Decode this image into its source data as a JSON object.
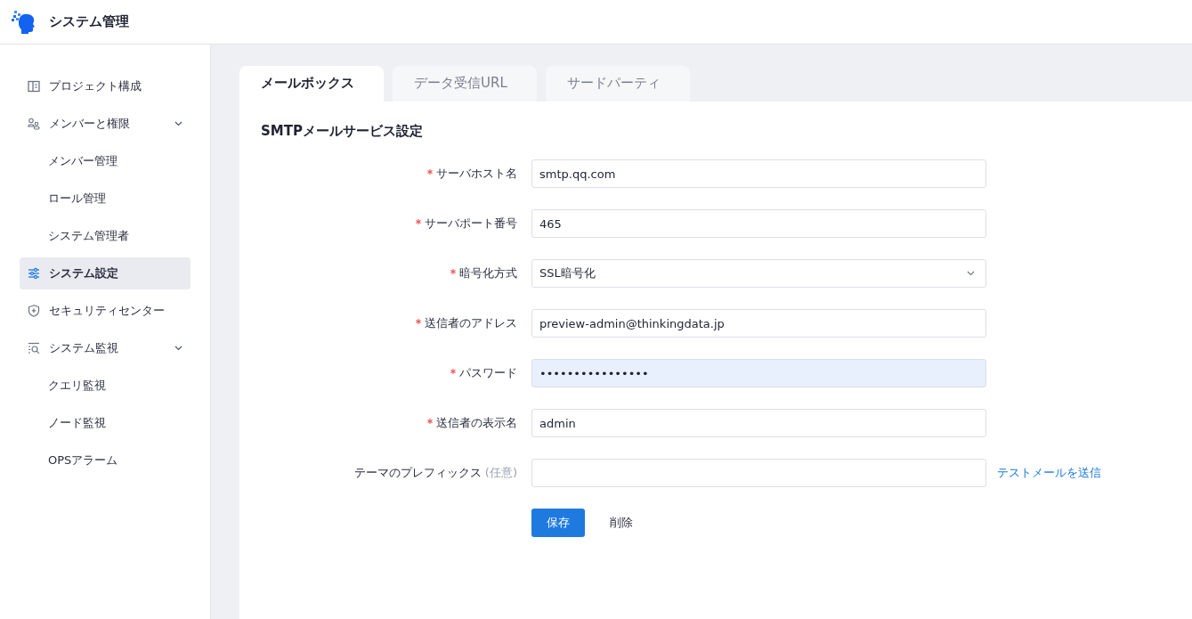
{
  "header": {
    "title": "システム管理"
  },
  "sidebar": {
    "items": [
      {
        "label": "プロジェクト構成",
        "selected": false
      },
      {
        "label": "メンバーと権限",
        "selected": false,
        "expanded": true,
        "children": [
          {
            "label": "メンバー管理",
            "selected": false
          },
          {
            "label": "ロール管理",
            "selected": false
          },
          {
            "label": "システム管理者",
            "selected": false
          }
        ]
      },
      {
        "label": "システム設定",
        "selected": true
      },
      {
        "label": "セキュリティセンター",
        "selected": false
      },
      {
        "label": "システム監視",
        "selected": false,
        "expanded": true,
        "children": [
          {
            "label": "クエリ監視",
            "selected": false
          },
          {
            "label": "ノード監視",
            "selected": false
          },
          {
            "label": "OPSアラーム",
            "selected": false
          }
        ]
      }
    ]
  },
  "tabs": [
    {
      "label": "メールボックス",
      "selected": true
    },
    {
      "label": "データ受信URL",
      "selected": false
    },
    {
      "label": "サードパーティ",
      "selected": false
    }
  ],
  "section_title": "SMTPメールサービス設定",
  "fields": [
    {
      "label": "サーバホスト名",
      "required": true,
      "kind": "text",
      "value": "smtp.qq.com"
    },
    {
      "label": "サーバポート番号",
      "required": true,
      "kind": "text",
      "value": "465"
    },
    {
      "label": "暗号化方式",
      "required": true,
      "kind": "select",
      "value": "SSL暗号化"
    },
    {
      "label": "送信者のアドレス",
      "required": true,
      "kind": "text",
      "value": "preview-admin@thinkingdata.jp"
    },
    {
      "label": "パスワード",
      "required": true,
      "kind": "password",
      "value": "••••••••••••••••"
    },
    {
      "label": "送信者の表示名",
      "required": true,
      "kind": "text",
      "value": "admin"
    },
    {
      "label": "テーマのプレフィックス",
      "optional_note": "(任意)",
      "required": false,
      "kind": "text",
      "link": "テストメールを送信"
    }
  ],
  "buttons": {
    "save": "保存",
    "delete": "削除"
  }
}
